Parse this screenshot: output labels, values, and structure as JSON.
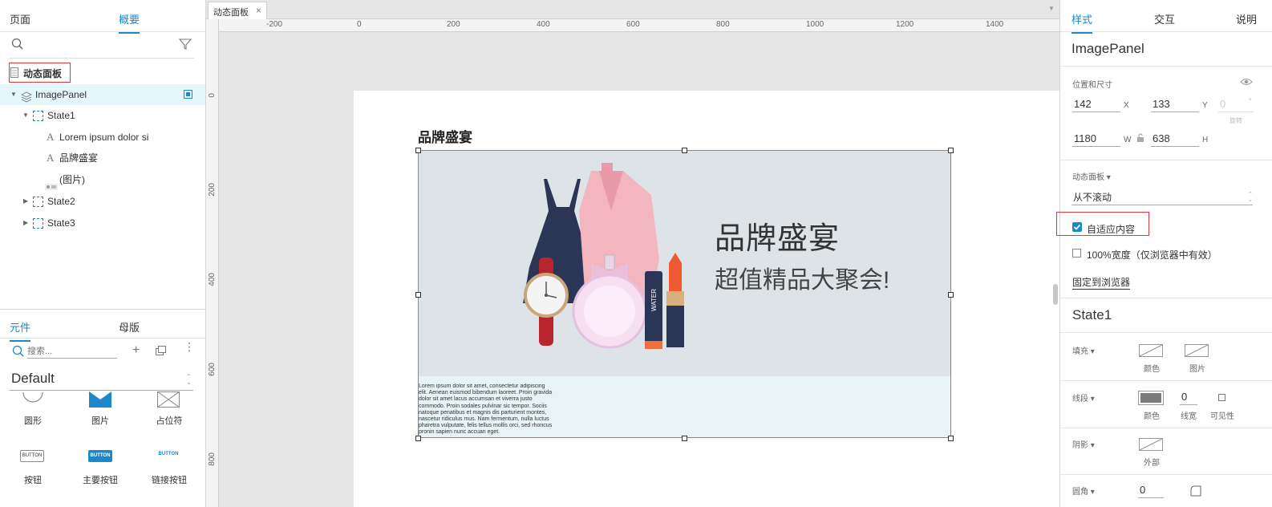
{
  "left_panel": {
    "tabs": [
      "页面",
      "概要"
    ],
    "active_tab": "概要",
    "page_name": "动态面板",
    "tree": {
      "root": "ImagePanel",
      "state1": "State1",
      "child_text1": "Lorem ipsum dolor si",
      "child_text2": "品牌盛宴",
      "child_image": "(图片)",
      "state2": "State2",
      "state3": "State3"
    },
    "lib_tabs": [
      "元件",
      "母版"
    ],
    "lib_active": "元件",
    "search_placeholder": "搜索...",
    "library_name": "Default",
    "widgets_row1": [
      "圆形",
      "图片",
      "占位符"
    ],
    "widgets_row2": [
      "按钮",
      "主要按钮",
      "链接按钮"
    ],
    "button_text": "BUTTON"
  },
  "canvas": {
    "doc_tab": "动态面板",
    "ruler_h": [
      "-200",
      "0",
      "200",
      "400",
      "600",
      "800",
      "1000",
      "1200",
      "1400"
    ],
    "ruler_v": [
      "0",
      "200",
      "400",
      "600",
      "800"
    ],
    "heading": "品牌盛宴",
    "banner_title": "品牌盛宴",
    "banner_subtitle": "超值精品大聚会!",
    "watch_text": "WATER",
    "lorem": "Lorem ipsum dolor sit amet, consectetur adipiscing elit. Aenean euismod bibendum laoreet. Proin gravida dolor sit amet lacus accumsan et viverra justo commodo. Proin sodales pulvinar sic tempor. Sociis natoque penatibus et magnis dis parturient montes, nascetur ridiculus mus. Nam fermentum, nulla luctus pharetra vulputate, felis tellus mollis orci, sed rhoncus pronin sapien nunc accuan eget."
  },
  "right_panel": {
    "tabs": [
      "样式",
      "交互",
      "说明"
    ],
    "active_tab": "样式",
    "element_name": "ImagePanel",
    "pos_size_label": "位置和尺寸",
    "x": "142",
    "x_label": "X",
    "y": "133",
    "y_label": "Y",
    "rotation": "0",
    "rotation_unit": "°",
    "rotation_label": "旋转",
    "w": "1180",
    "w_label": "W",
    "h": "638",
    "h_label": "H",
    "dynamic_panel_label": "动态面板 ▾",
    "scroll_option": "从不滚动",
    "fit_content": "自适应内容",
    "fit_content_checked": true,
    "full_width": "100%宽度（仅浏览器中有效）",
    "pin_browser": "固定到浏览器",
    "state_name": "State1",
    "fill_label": "填充 ▾",
    "fill_color": "颜色",
    "fill_image": "图片",
    "border_label": "线段 ▾",
    "border_color": "颜色",
    "border_width": "0",
    "border_width_label": "线宽",
    "border_visibility": "可见性",
    "shadow_label": "阴影 ▾",
    "shadow_outer": "外部",
    "corner_label": "圆角 ▾",
    "corner_value": "0"
  },
  "colors": {
    "accent": "#1a88c9",
    "selection": "#1fb5c4",
    "highlight_box": "#e0393e",
    "banner_bg": "#dde3e6"
  }
}
